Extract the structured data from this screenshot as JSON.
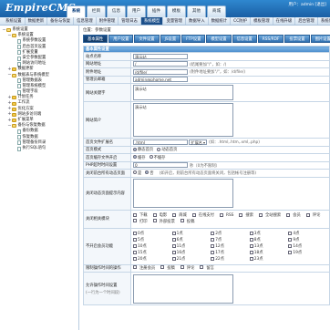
{
  "header": {
    "logo": "EmpireCMS",
    "tabs": [
      "系统",
      "栏目",
      "信息",
      "用户",
      "插件",
      "模板",
      "其他",
      "商城"
    ],
    "active_tab": 0,
    "user_text": "用户：admin [退出]"
  },
  "menubar": [
    "系统设置",
    "数据更新",
    "备份与恢复",
    "信息管理",
    "附件管理",
    "管理日志",
    "系统模型",
    "变量管理",
    "数据导入",
    "数据统计",
    "CC防护",
    "模板管理",
    "在线升级",
    "后台管理",
    "系统信息"
  ],
  "menubar_highlight": 6,
  "sidebar": {
    "items": [
      {
        "label": "系统设置",
        "level": 0,
        "type": "folder",
        "open": true
      },
      {
        "label": "系统设置",
        "level": 1,
        "type": "folder",
        "open": true
      },
      {
        "label": "系统参数设置",
        "level": 2,
        "type": "leaf"
      },
      {
        "label": "后台首页设置",
        "level": 2,
        "type": "leaf"
      },
      {
        "label": "扩展变量",
        "level": 2,
        "type": "leaf"
      },
      {
        "label": "安全参数配置",
        "level": 2,
        "type": "leaf"
      },
      {
        "label": "网站访问地址",
        "level": 2,
        "type": "leaf"
      },
      {
        "label": "数据更新",
        "level": 1,
        "type": "folder",
        "open": false
      },
      {
        "label": "数据表与系统模型",
        "level": 1,
        "type": "folder",
        "open": true
      },
      {
        "label": "管理数据表",
        "level": 2,
        "type": "leaf"
      },
      {
        "label": "管理系统模型",
        "level": 2,
        "type": "leaf"
      },
      {
        "label": "管理字段",
        "level": 2,
        "type": "leaf"
      },
      {
        "label": "计划任务",
        "level": 1,
        "type": "folder",
        "open": false
      },
      {
        "label": "工作流",
        "level": 1,
        "type": "folder",
        "open": false
      },
      {
        "label": "优化方案",
        "level": 1,
        "type": "folder",
        "open": false
      },
      {
        "label": "网站多访问端",
        "level": 1,
        "type": "folder",
        "open": false
      },
      {
        "label": "扩展菜单",
        "level": 1,
        "type": "folder",
        "open": false
      },
      {
        "label": "备份与恢复数据",
        "level": 1,
        "type": "folder",
        "open": true
      },
      {
        "label": "备份数据",
        "level": 2,
        "type": "leaf"
      },
      {
        "label": "恢复数据",
        "level": 2,
        "type": "leaf"
      },
      {
        "label": "管理备份目录",
        "level": 2,
        "type": "leaf"
      },
      {
        "label": "执行SQL语句",
        "level": 2,
        "type": "leaf"
      }
    ]
  },
  "main": {
    "breadcrumb": "位置：参数设置",
    "tabs": [
      "基本属性",
      "用户设置",
      "文件设置",
      "JS设置",
      "FTP设置",
      "模型设置",
      "信息设置",
      "RSS/RDF",
      "投票设置",
      "图片设置"
    ],
    "active_tab": 0,
    "section_title": "基本属性设置",
    "fields": {
      "site_name": {
        "label": "站点名称",
        "value": "演示站"
      },
      "site_url": {
        "label": "网站地址",
        "value": "/",
        "hint": "(结尾要加\"/\"，如：/)"
      },
      "attach_url": {
        "label": "附件地址",
        "value": "/d/file/",
        "hint": "(附件地址要加\"/\"，如：/d/file/)"
      },
      "admin_email": {
        "label": "管理员邮箱",
        "value": "admin@phome.net"
      },
      "keywords": {
        "label": "网站关键字",
        "value": "演示站"
      },
      "description": {
        "label": "网站简介",
        "value": "演示站"
      },
      "index_ext": {
        "label": "首页文件扩展名",
        "value": ".html",
        "select": "扩展名",
        "hint": "(如：.html,.htm,.xml,.php)"
      },
      "index_mode": {
        "label": "首页模式",
        "options": [
          "静态首页",
          "动态首页"
        ],
        "selected": 0
      },
      "index_sort": {
        "label": "首页缓存文件开启",
        "options": [
          "缓存",
          "不缓存"
        ],
        "selected": 0
      },
      "php_timeout": {
        "label": "PHP超时时间设置",
        "value": "0",
        "hint": "秒（0为不限制）"
      },
      "close_site": {
        "label": "关闭前台所有动态页面",
        "options": [
          "是",
          "否"
        ],
        "selected": 1,
        "hint": "(如开启，则前台所有动态页面将关闭，包括帐号注册等)"
      },
      "close_msg": {
        "label": "关闭动态页面提示内容",
        "value": ""
      },
      "close_modules": {
        "label": "关闭相关模块",
        "options": [
          "下载",
          "电影",
          "商城",
          "在线支付",
          "RSS",
          "搜索",
          "全站搜索",
          "会员",
          "评论",
          "打印",
          "外部投票",
          "投稿"
        ]
      },
      "open_reg": {
        "label": "不开启会员功能"
      },
      "limit_ops": {
        "label": "限制操作时间的操作",
        "options": [
          "注册会员",
          "投稿",
          "评论",
          "留言"
        ]
      },
      "allow_ips": {
        "label": "允许操作时间设置",
        "value": "",
        "note": "(一行为一个时间段)"
      }
    },
    "ranges": [
      "0点",
      "1点",
      "2点",
      "3点",
      "4点",
      "5点",
      "6点",
      "7点",
      "8点",
      "9点",
      "10点",
      "11点",
      "12点",
      "13点",
      "14点",
      "15点",
      "16点",
      "17点",
      "18点",
      "19点",
      "20点",
      "21点",
      "22点",
      "23点"
    ]
  },
  "colors": {
    "header": "#1a5fa4",
    "accent": "#2f6fb0",
    "border": "#c6d6e6"
  }
}
